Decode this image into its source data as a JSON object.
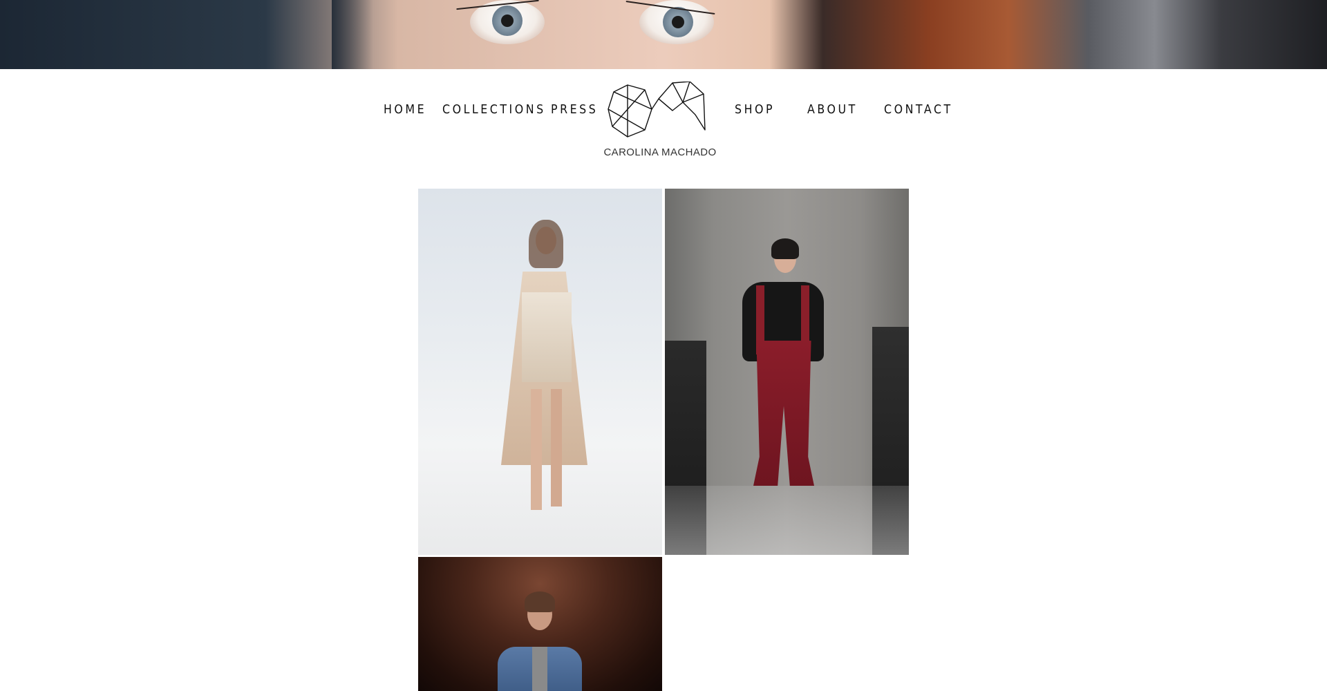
{
  "hero": {
    "alt": "Close-up of model's eyes"
  },
  "nav": {
    "left": [
      "HOME",
      "COLLECTIONS",
      "PRESS"
    ],
    "right": [
      "SHOP",
      "ABOUT",
      "CONTACT"
    ]
  },
  "brand": {
    "name": "CAROLINA MACHADO"
  },
  "gallery": {
    "tiles": [
      {
        "alt": "Model in beige satin wrap dress and long coat on runway"
      },
      {
        "alt": "Model in black sweater and burgundy suspender trousers on runway"
      },
      {
        "alt": "Model in blue coat on runway with dark curtain background"
      }
    ]
  },
  "colors": {
    "text": "#111111",
    "background": "#ffffff"
  }
}
